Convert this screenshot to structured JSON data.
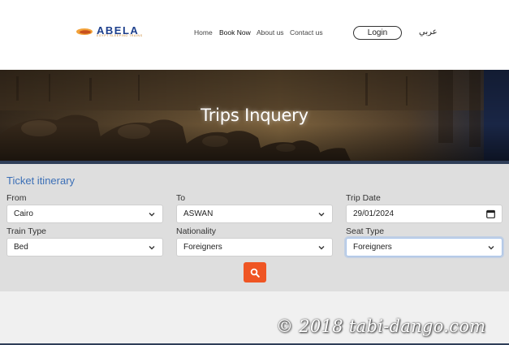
{
  "header": {
    "logo_text": "ABELA",
    "logo_tagline": "EGYPT SLEEPING TRAINS",
    "nav": {
      "home": "Home",
      "book_now": "Book Now",
      "about_us": "About us",
      "contact_us": "Contact us"
    },
    "login_label": "Login",
    "language_label": "عربي"
  },
  "hero": {
    "title": "Trips Inquery"
  },
  "form": {
    "section_title": "Ticket itinerary",
    "from": {
      "label": "From",
      "value": "Cairo"
    },
    "to": {
      "label": "To",
      "value": "ASWAN"
    },
    "trip_date": {
      "label": "Trip Date",
      "value": "29/01/2024"
    },
    "train_type": {
      "label": "Train Type",
      "value": "Bed"
    },
    "nationality": {
      "label": "Nationality",
      "value": "Foreigners"
    },
    "seat_type": {
      "label": "Seat Type",
      "value": "Foreigners"
    },
    "search_icon": "search-icon"
  },
  "watermark": "© 2018 tabi-dango.com",
  "colors": {
    "brand_blue": "#1d3f8c",
    "accent_orange": "#ef5523",
    "section_title_blue": "#3b6fb6",
    "panel_gray": "#dedede"
  }
}
